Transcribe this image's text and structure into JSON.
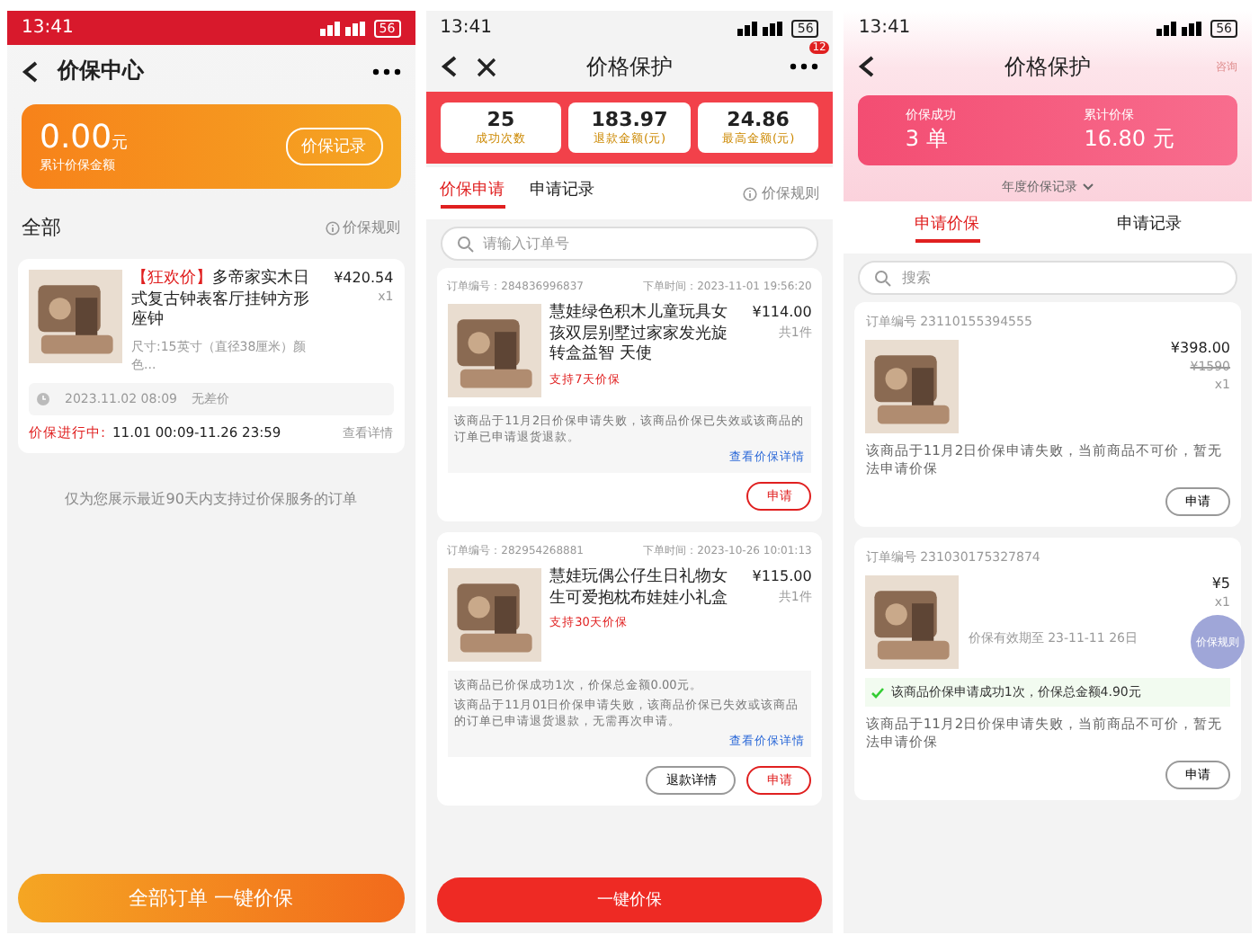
{
  "panels": [
    {
      "kind": "center",
      "status": {
        "time": "13:41",
        "battery": "56"
      },
      "title": "价保中心",
      "summary": {
        "amount": "0.00",
        "unit": "元",
        "label": "累计价保金额",
        "button": "价保记录"
      },
      "section": {
        "title": "全部",
        "rule": "价保规则"
      },
      "order": {
        "tag": "【狂欢价】",
        "name": "多帝家实木日式复古钟表客厅挂钟方形座钟",
        "spec": "尺寸:15英寸（直径38厘米）颜色...",
        "price": "¥420.54",
        "qty": "x1",
        "time": "2023.11.02 08:09",
        "status": "无差价",
        "progress_label": "价保进行中:",
        "progress_time": "11.01 00:09-11.26 23:59",
        "detail": "查看详情"
      },
      "notice": "仅为您展示最近90天内支持过价保服务的订单",
      "bottom_button": "全部订单 一键价保"
    },
    {
      "kind": "protect",
      "status": {
        "time": "13:41",
        "battery": "56"
      },
      "title": "价格保护",
      "badge": "12",
      "stats": [
        {
          "value": "25",
          "label": "成功次数"
        },
        {
          "value": "183.97",
          "label": "退款金额(元)"
        },
        {
          "value": "24.86",
          "label": "最高金额(元)"
        }
      ],
      "tabs": [
        {
          "label": "价保申请",
          "selected": true
        },
        {
          "label": "申请记录",
          "selected": false
        }
      ],
      "rule": "价保规则",
      "search_placeholder": "请输入订单号",
      "orders": [
        {
          "order_no": "订单编号：284836996837",
          "time": "下单时间：2023-11-01 19:56:20",
          "name": "慧娃绿色积木儿童玩具女孩双层别墅过家家发光旋转盒益智 天使",
          "tag": "支持7天价保",
          "price": "¥114.00",
          "qty": "共1件",
          "notes": [
            "该商品于11月2日价保申请失败，该商品价保已失效或该商品的订单已申请退货退款。"
          ],
          "link": "查看价保详情",
          "buttons": [
            "申请"
          ]
        },
        {
          "order_no": "订单编号：282954268881",
          "time": "下单时间：2023-10-26 10:01:13",
          "name": "慧娃玩偶公仔生日礼物女生可爱抱枕布娃娃小礼盒",
          "tag": "支持30天价保",
          "price": "¥115.00",
          "qty": "共1件",
          "notes": [
            "该商品已价保成功1次，价保总金额0.00元。",
            "该商品于11月01日价保申请失败，该商品价保已失效或该商品的订单已申请退货退款，无需再次申请。"
          ],
          "link": "查看价保详情",
          "buttons": [
            "退款详情",
            "申请"
          ]
        }
      ],
      "bottom_button": "一键价保"
    },
    {
      "kind": "records",
      "status": {
        "time": "13:41",
        "battery": "56"
      },
      "title": "价格保护",
      "corner": "咨询",
      "stats": [
        {
          "value": "3",
          "unit": "单",
          "label": "价保成功"
        },
        {
          "value": "16.80",
          "unit": "元",
          "label": "累计价保"
        }
      ],
      "range": "年度价保记录",
      "tabs": [
        {
          "label": "申请价保",
          "selected": true
        },
        {
          "label": "申请记录",
          "selected": false
        }
      ],
      "search_placeholder": "搜索",
      "orders": [
        {
          "order_no": "订单编号 23110155394555",
          "price": "¥398.00",
          "old_price": "¥1590",
          "qty": "x1",
          "message": "该商品于11月2日价保申请失败，当前商品不可价，暂无法申请价保",
          "buttons": [
            "申请"
          ]
        },
        {
          "order_no": "订单编号 231030175327874",
          "price": "¥5",
          "qty": "x1",
          "time": "价保有效期至 23-11-11 26日",
          "success": "该商品价保申请成功1次，价保总金额4.90元",
          "message": "该商品于11月2日价保申请失败，当前商品不可价，暂无法申请价保",
          "buttons": [
            "申请"
          ]
        }
      ],
      "float_button": "价保规则"
    }
  ]
}
